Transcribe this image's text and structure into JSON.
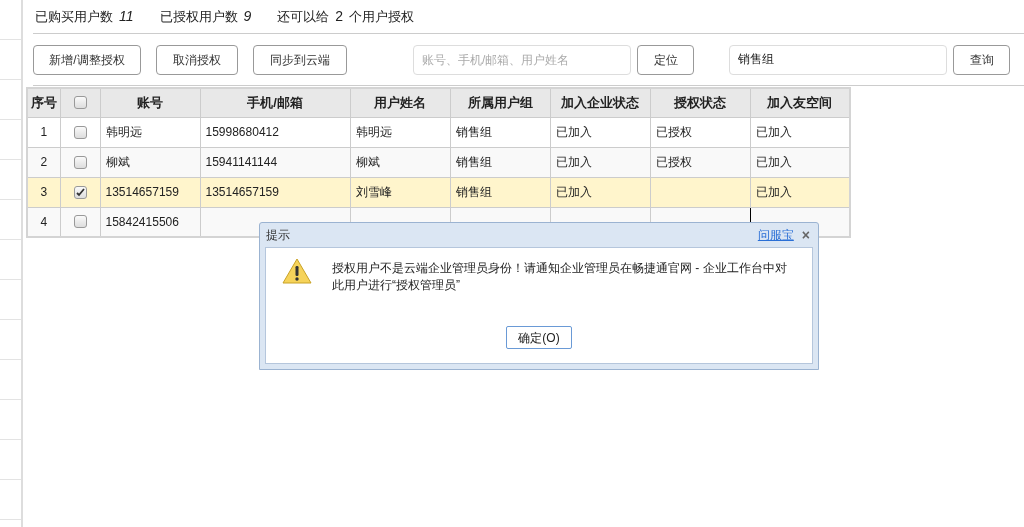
{
  "stats": {
    "purchased": {
      "label": "已购买用户数",
      "value": "11"
    },
    "authorized": {
      "label": "已授权用户数",
      "value": "9"
    },
    "remaining": {
      "prefix": "还可以给",
      "value": "2",
      "suffix": "个用户授权"
    }
  },
  "toolbar": {
    "buttons": [
      "新增/调整授权",
      "取消授权",
      "同步到云端"
    ],
    "locate": {
      "placeholder": "账号、手机/邮箱、用户姓名",
      "button": "定位"
    },
    "query": {
      "value": "销售组",
      "button": "查询"
    }
  },
  "table": {
    "columns": [
      "序号",
      "",
      "账号",
      "手机/邮箱",
      "用户姓名",
      "所属用户组",
      "加入企业状态",
      "授权状态",
      "加入友空间"
    ],
    "header_checked": false,
    "rows": [
      {
        "index": "1",
        "checked": false,
        "selected": false,
        "account": "韩明远",
        "phone": "15998680412",
        "name": "韩明远",
        "group": "销售组",
        "join_status": "已加入",
        "auth_status": "已授权",
        "space_status": "已加入",
        "auth_focused": false
      },
      {
        "index": "2",
        "checked": false,
        "selected": false,
        "account": "柳斌",
        "phone": "15941141144",
        "name": "柳斌",
        "group": "销售组",
        "join_status": "已加入",
        "auth_status": "已授权",
        "space_status": "已加入",
        "auth_focused": false
      },
      {
        "index": "3",
        "checked": true,
        "selected": true,
        "account": "13514657159",
        "phone": "13514657159",
        "name": "刘雪峰",
        "group": "销售组",
        "join_status": "已加入",
        "space_status": "已加入",
        "auth_focused": false
      },
      {
        "index": "4",
        "checked": false,
        "selected": false,
        "account": "15842415506",
        "auth_focused": true
      }
    ]
  },
  "dialog": {
    "title": "提示",
    "help_link": "问服宝",
    "close": "×",
    "message": "授权用户不是云端企业管理员身份！请通知企业管理员在畅捷通官网 - 企业工作台中对此用户进行“授权管理员”",
    "ok": "确定(O)"
  }
}
